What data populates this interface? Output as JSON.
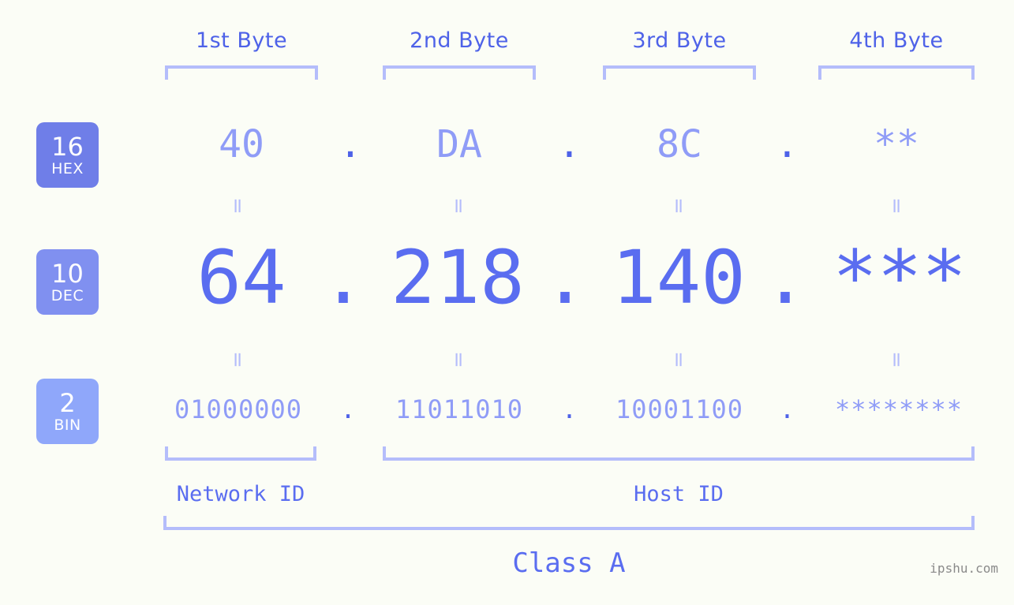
{
  "page": {
    "background_color": "#fbfdf6",
    "accent_strong": "#4e62e8",
    "accent_medium": "#5a6df0",
    "accent_light": "#8f9cf7",
    "accent_pale": "#b4bdfb",
    "watermark": "ipshu.com"
  },
  "byte_headers": [
    {
      "label": "1st Byte"
    },
    {
      "label": "2nd Byte"
    },
    {
      "label": "3rd Byte"
    },
    {
      "label": "4th Byte"
    }
  ],
  "bases": [
    {
      "number": "16",
      "name": "HEX",
      "color": "#6f7ee8"
    },
    {
      "number": "10",
      "name": "DEC",
      "color": "#8090f0"
    },
    {
      "number": "2",
      "name": "BIN",
      "color": "#8fa7fa"
    }
  ],
  "rows": {
    "hex": {
      "base_number": "16",
      "base_name": "HEX",
      "values": [
        "40",
        "DA",
        "8C",
        "**"
      ],
      "separator": "."
    },
    "dec": {
      "base_number": "10",
      "base_name": "DEC",
      "values": [
        "64",
        "218",
        "140",
        "***"
      ],
      "separator": "."
    },
    "bin": {
      "base_number": "2",
      "base_name": "BIN",
      "values": [
        "01000000",
        "11011010",
        "10001100",
        "********"
      ],
      "separator": "."
    }
  },
  "equals": {
    "glyph": "=",
    "count_per_gap": 4
  },
  "footer": {
    "network_id_label": "Network ID",
    "host_id_label": "Host ID",
    "class_label": "Class A"
  }
}
